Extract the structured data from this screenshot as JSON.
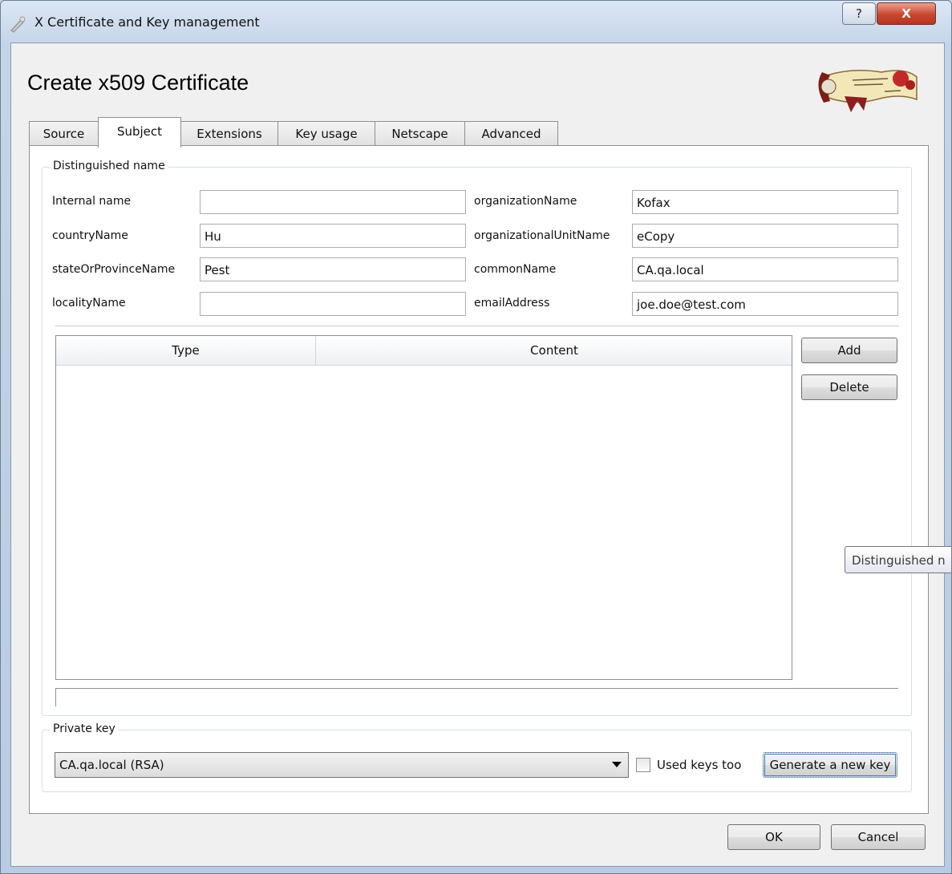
{
  "window": {
    "title": "X Certificate and Key management",
    "help_label": "?",
    "close_label": "X"
  },
  "dialog": {
    "heading": "Create x509 Certificate"
  },
  "tabs": [
    {
      "label": "Source"
    },
    {
      "label": "Subject"
    },
    {
      "label": "Extensions"
    },
    {
      "label": "Key usage"
    },
    {
      "label": "Netscape"
    },
    {
      "label": "Advanced"
    }
  ],
  "active_tab": "Subject",
  "distinguished_name": {
    "group_title": "Distinguished name",
    "fields": {
      "internal_name": {
        "label": "Internal name",
        "value": ""
      },
      "country_name": {
        "label": "countryName",
        "value": "Hu"
      },
      "state_or_province_name": {
        "label": "stateOrProvinceName",
        "value": "Pest"
      },
      "locality_name": {
        "label": "localityName",
        "value": ""
      },
      "organization_name": {
        "label": "organizationName",
        "value": "Kofax"
      },
      "organizational_unit_name": {
        "label": "organizationalUnitName",
        "value": "eCopy"
      },
      "common_name": {
        "label": "commonName",
        "value": "CA.qa.local"
      },
      "email_address": {
        "label": "emailAddress",
        "value": "joe.doe@test.com"
      }
    },
    "table": {
      "columns": [
        "Type",
        "Content"
      ],
      "rows": []
    },
    "add_label": "Add",
    "delete_label": "Delete"
  },
  "private_key": {
    "group_title": "Private key",
    "selected": "CA.qa.local (RSA)",
    "used_keys_too_label": "Used keys too",
    "used_keys_too_checked": false,
    "generate_label": "Generate a new key"
  },
  "footer": {
    "ok_label": "OK",
    "cancel_label": "Cancel"
  },
  "tooltip": {
    "text": "Distinguished n"
  }
}
